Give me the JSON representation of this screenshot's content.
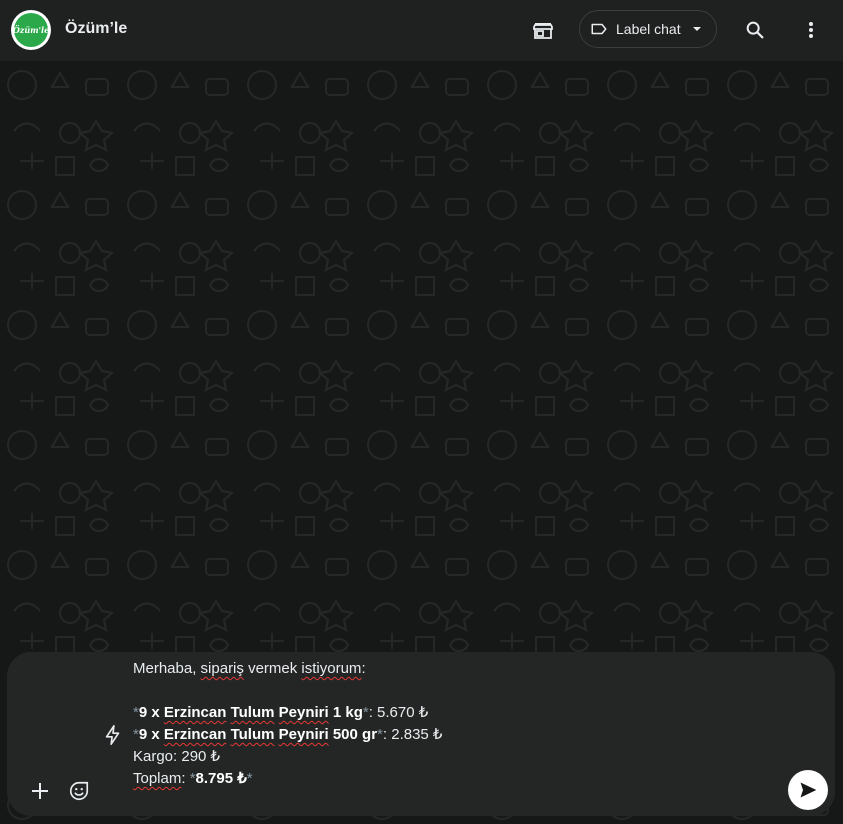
{
  "header": {
    "contact_name": "Özüm’le",
    "avatar_text": "Özüm'le",
    "label_chat": "Label chat"
  },
  "icons": {
    "store": "store-icon",
    "label": "label-tag-icon",
    "dropdown": "caret-down-icon",
    "search": "search-icon",
    "menu": "kebab-menu-icon",
    "attach": "plus-icon",
    "sticker": "sticker-icon",
    "quick_reply": "lightning-icon",
    "send": "send-icon"
  },
  "composer": {
    "line1_a": "Merhaba, ",
    "line1_b": "sipariş",
    "line1_c": " vermek ",
    "line1_d": "istiyorum",
    "line1_e": ":",
    "item1": {
      "qty": "9 x ",
      "w1": "Erzincan",
      "w2": "Tulum",
      "w3": "Peyniri",
      "size": " 1 kg",
      "price": ": 5.670 ₺"
    },
    "item2": {
      "qty": "9 x ",
      "w1": "Erzincan",
      "w2": "Tulum",
      "w3": "Peyniri",
      "size": " 500 gr",
      "price": ": 2.835 ₺"
    },
    "shipping": "Kargo: 290 ₺",
    "total_label": "Toplam",
    "total_sep": ": ",
    "total_value": "8.795 ₺",
    "asterisk": "*"
  },
  "colors": {
    "header_bg": "#1f2020",
    "chat_bg": "#161717",
    "composer_bg": "#242626",
    "text": "#e9edef",
    "spell_underline": "#e53935"
  }
}
